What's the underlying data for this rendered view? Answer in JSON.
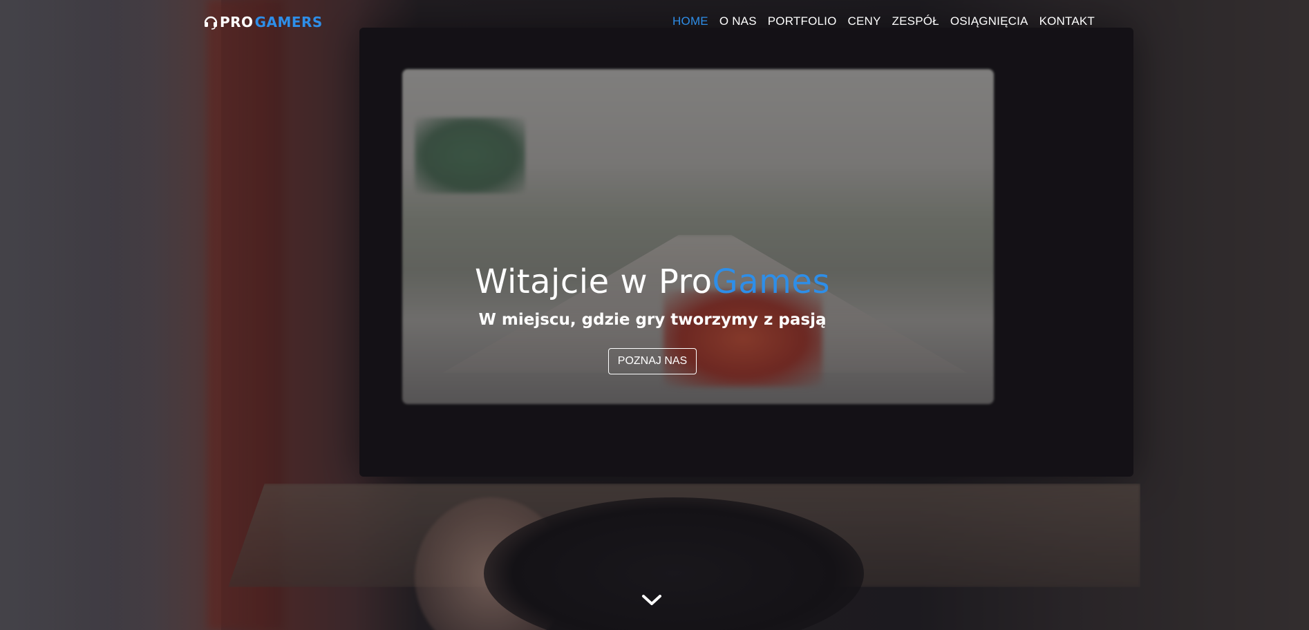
{
  "brand": {
    "logo_icon": "headset-icon",
    "logo_part1": "PRO",
    "logo_part2": "GAMERS",
    "accent_color": "#2e8ee8"
  },
  "nav": {
    "items": [
      {
        "label": "HOME",
        "active": true
      },
      {
        "label": "O NAS",
        "active": false
      },
      {
        "label": "PORTFOLIO",
        "active": false
      },
      {
        "label": "CENY",
        "active": false
      },
      {
        "label": "ZESPÓŁ",
        "active": false
      },
      {
        "label": "OSIĄGNIĘCIA",
        "active": false
      },
      {
        "label": "KONTAKT",
        "active": false
      }
    ]
  },
  "hero": {
    "headline_part1": "Witajcie w Pro",
    "headline_part2": "Games",
    "subheadline": "W miejscu, gdzie gry tworzymy z pasją",
    "cta_label": "POZNAJ NAS",
    "scroll_icon": "chevron-down-icon"
  }
}
